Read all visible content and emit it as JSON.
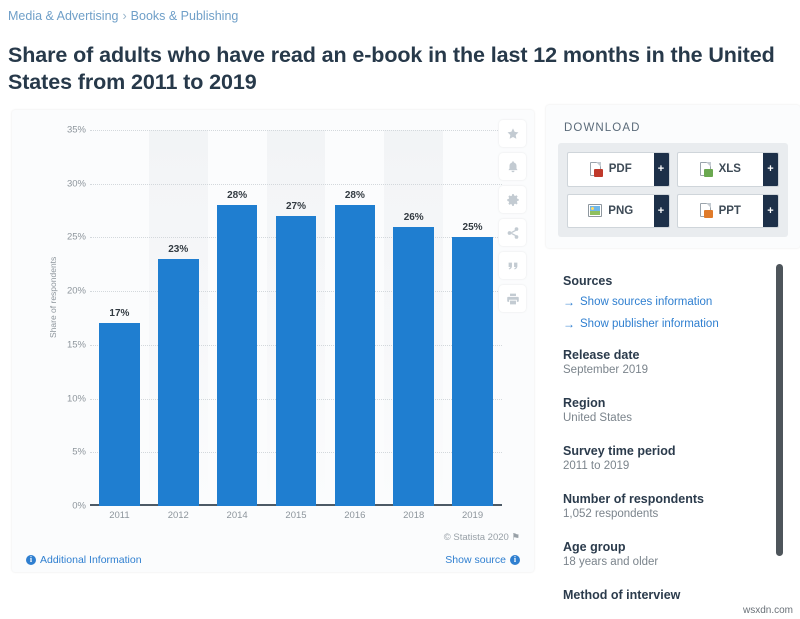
{
  "breadcrumb": {
    "items": [
      {
        "label": "Media & Advertising"
      },
      {
        "label": "Books & Publishing"
      }
    ],
    "separator": "›"
  },
  "page_title": "Share of adults who have read an e-book in the last 12 months in the United States from 2011 to 2019",
  "chart_data": {
    "type": "bar",
    "title": "",
    "xlabel": "",
    "ylabel": "Share of respondents",
    "categories": [
      "2011",
      "2012",
      "2014",
      "2015",
      "2016",
      "2018",
      "2019"
    ],
    "values": [
      17,
      23,
      28,
      27,
      28,
      26,
      25
    ],
    "value_labels": [
      "17%",
      "23%",
      "28%",
      "27%",
      "28%",
      "26%",
      "25%"
    ],
    "ylim": [
      0,
      35
    ],
    "yticks": [
      0,
      5,
      10,
      15,
      20,
      25,
      30,
      35
    ],
    "ytick_labels": [
      "0%",
      "5%",
      "10%",
      "15%",
      "20%",
      "25%",
      "30%",
      "35%"
    ],
    "grid": true,
    "legend": false,
    "bar_color": "#1f7ed0"
  },
  "chart_tools": [
    {
      "name": "star-icon",
      "title": "Add to favorites"
    },
    {
      "name": "bell-icon",
      "title": "Notifications"
    },
    {
      "name": "gear-icon",
      "title": "Settings"
    },
    {
      "name": "share-icon",
      "title": "Share"
    },
    {
      "name": "quote-icon",
      "title": "Cite"
    },
    {
      "name": "print-icon",
      "title": "Print"
    }
  ],
  "chart_footer": {
    "copyright": "© Statista 2020",
    "flag_icon": "⚑",
    "additional_information": "Additional Information",
    "show_source": "Show source",
    "info_glyph": "i"
  },
  "download": {
    "title": "DOWNLOAD",
    "plus_label": "+",
    "buttons": [
      {
        "label": "PDF",
        "icon": "pdf-file-icon",
        "color": "#c0392b"
      },
      {
        "label": "XLS",
        "icon": "xls-file-icon",
        "color": "#6aa84f"
      },
      {
        "label": "PNG",
        "icon": "png-image-icon",
        "color": "#6fb7e8"
      },
      {
        "label": "PPT",
        "icon": "ppt-file-icon",
        "color": "#e07b2a"
      }
    ]
  },
  "sources": {
    "heading": "Sources",
    "links": [
      {
        "label": "Show sources information",
        "arrow": "→"
      },
      {
        "label": "Show publisher information",
        "arrow": "→"
      }
    ],
    "fields": [
      {
        "label": "Release date",
        "value": "September 2019"
      },
      {
        "label": "Region",
        "value": "United States"
      },
      {
        "label": "Survey time period",
        "value": "2011 to 2019"
      },
      {
        "label": "Number of respondents",
        "value": "1,052 respondents"
      },
      {
        "label": "Age group",
        "value": "18 years and older"
      },
      {
        "label": "Method of interview",
        "value": ""
      }
    ]
  },
  "watermark": "wsxdn.com"
}
